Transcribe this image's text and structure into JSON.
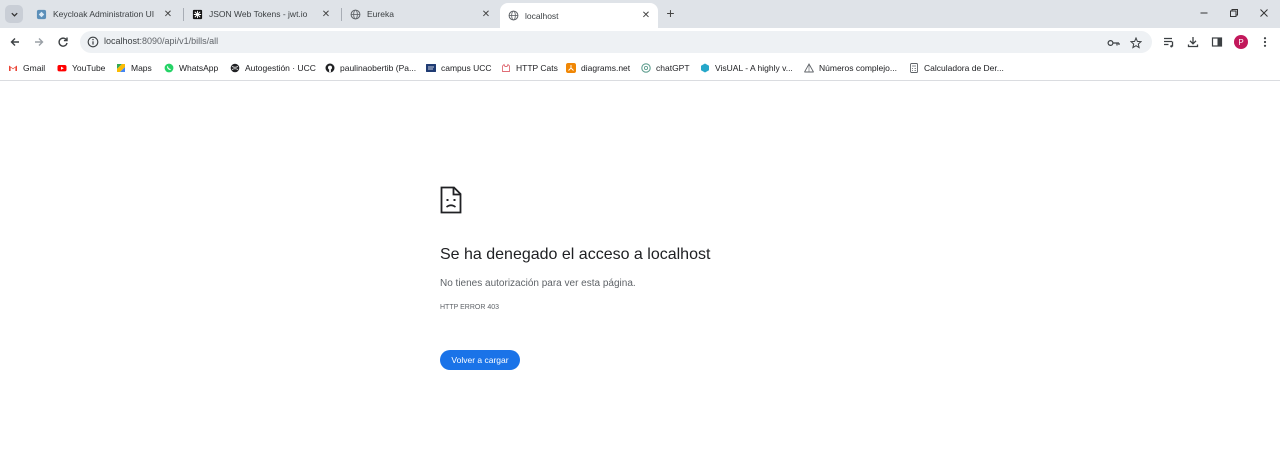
{
  "tabs": [
    {
      "title": "Keycloak Administration UI",
      "favicon": "keycloak-icon"
    },
    {
      "title": "JSON Web Tokens - jwt.io",
      "favicon": "jwt-icon"
    },
    {
      "title": "Eureka",
      "favicon": "globe-icon"
    },
    {
      "title": "localhost",
      "favicon": "globe-icon",
      "active": true
    }
  ],
  "address_bar": {
    "host": "localhost",
    "path": ":8090/api/v1/bills/all"
  },
  "profile": {
    "initial": "P",
    "color": "#c2185b"
  },
  "bookmarks": [
    {
      "label": "Gmail",
      "icon": "gmail-icon"
    },
    {
      "label": "YouTube",
      "icon": "youtube-icon"
    },
    {
      "label": "Maps",
      "icon": "maps-icon"
    },
    {
      "label": "WhatsApp",
      "icon": "whatsapp-icon"
    },
    {
      "label": "Autogestión · UCC",
      "icon": "globe-icon"
    },
    {
      "label": "paulinaobertib (Pa...",
      "icon": "github-icon"
    },
    {
      "label": "campus UCC",
      "icon": "ucc-icon"
    },
    {
      "label": "HTTP Cats",
      "icon": "cat-icon"
    },
    {
      "label": "diagrams.net",
      "icon": "diagrams-icon"
    },
    {
      "label": "chatGPT",
      "icon": "chatgpt-icon"
    },
    {
      "label": "VisUAL - A highly v...",
      "icon": "visual-icon"
    },
    {
      "label": "Números complejo...",
      "icon": "triangle-icon"
    },
    {
      "label": "Calculadora de Der...",
      "icon": "calculator-icon"
    }
  ],
  "error_page": {
    "title": "Se ha denegado el acceso a localhost",
    "description": "No tienes autorización para ver esta página.",
    "code": "HTTP ERROR 403",
    "reload_label": "Volver a cargar",
    "accent": "#1a73e8"
  }
}
